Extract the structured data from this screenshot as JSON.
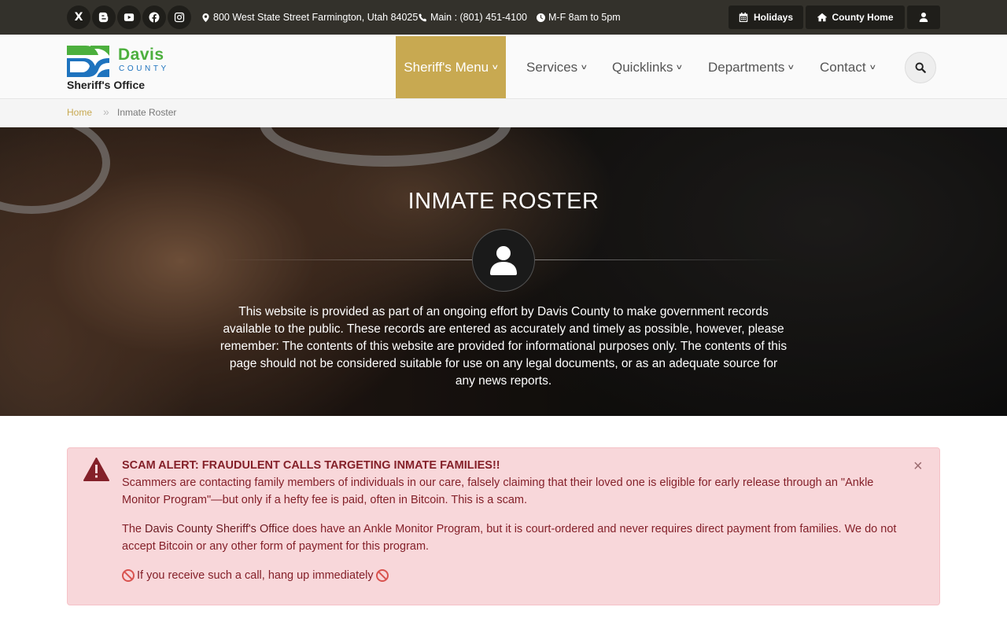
{
  "topbar": {
    "social": [
      {
        "name": "x-icon",
        "glyph": "X"
      },
      {
        "name": "blogger-icon"
      },
      {
        "name": "youtube-icon"
      },
      {
        "name": "facebook-icon"
      },
      {
        "name": "instagram-icon"
      }
    ],
    "address": "800 West State Street Farmington, Utah 84025",
    "phone": "Main : (801) 451-4100",
    "hours": "M-F 8am to 5pm",
    "buttons": {
      "holidays": "Holidays",
      "county_home": "County Home"
    }
  },
  "header": {
    "logo": {
      "davis": "Davis",
      "county": "COUNTY",
      "subtitle": "Sheriff's Office"
    },
    "nav": [
      {
        "label": "Sheriff's Menu",
        "active": true
      },
      {
        "label": "Services"
      },
      {
        "label": "Quicklinks"
      },
      {
        "label": "Departments"
      },
      {
        "label": "Contact"
      }
    ]
  },
  "breadcrumb": {
    "home": "Home",
    "separator": "»",
    "current": "Inmate Roster"
  },
  "hero": {
    "title": "INMATE ROSTER",
    "description": "This website is provided as part of an ongoing effort by Davis County to make government records available to the public. These records are entered as accurately and timely as possible, however, please remember: The contents of this website are provided for informational purposes only. The contents of this page should not be considered suitable for use on any legal documents, or as an adequate source for any news reports."
  },
  "alert": {
    "title": "SCAM ALERT: FRAUDULENT CALLS TARGETING INMATE FAMILIES!!",
    "p1": "Scammers are contacting family members of individuals in our care, falsely claiming that their loved one is eligible for early release through an \"Ankle Monitor Program\"—but only if a hefty fee is paid, often in Bitcoin. This is a scam.",
    "p2_prefix": "The ",
    "p2_strong": "Davis County Sheriff's Office",
    "p2_suffix": " does have an Ankle Monitor Program, but it is court-ordered and never requires direct payment from families. We do not accept Bitcoin or any other form of payment for this program.",
    "p3": "If you receive such a call, hang up immediately",
    "close": "×"
  },
  "colors": {
    "topbar_bg": "#33312b",
    "accent_gold": "#c8a951",
    "logo_green": "#4caf3d",
    "logo_blue": "#1e73be",
    "alert_bg": "#f8d7da",
    "alert_text": "#842029"
  }
}
